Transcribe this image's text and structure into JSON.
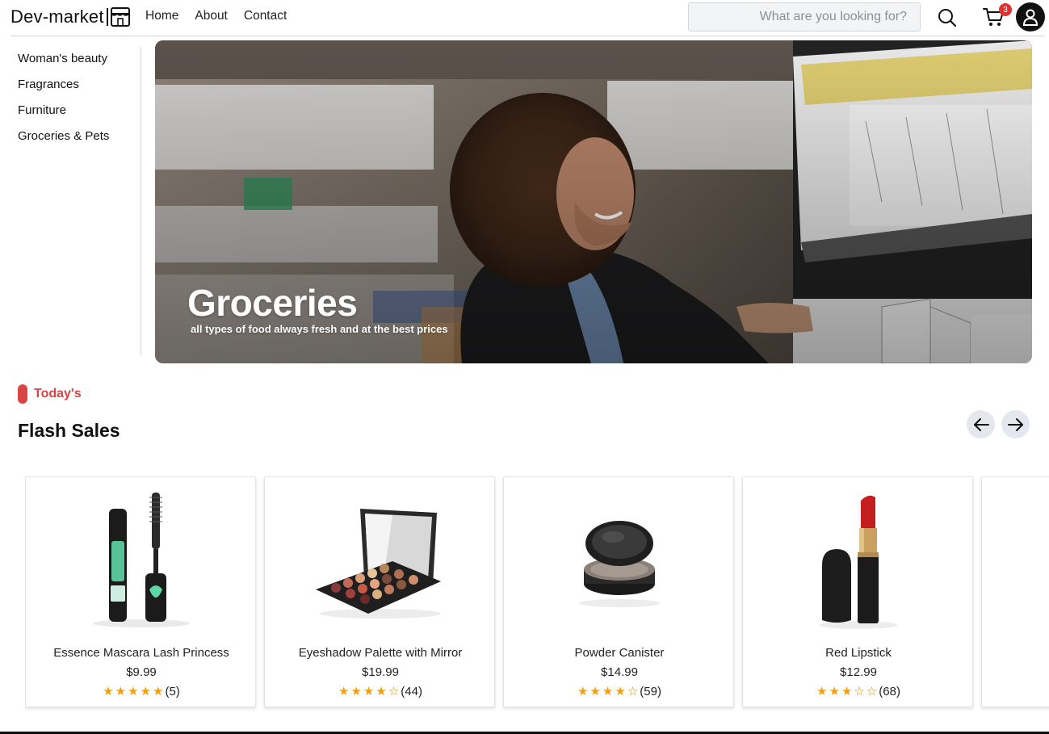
{
  "header": {
    "logo_text": "Dev-market",
    "nav": [
      "Home",
      "About",
      "Contact"
    ],
    "search_placeholder": "What are you looking for?",
    "cart_count": "3"
  },
  "sidebar": {
    "items": [
      "Woman's beauty",
      "Fragrances",
      "Furniture",
      "Groceries & Pets"
    ]
  },
  "hero": {
    "title": "Groceries",
    "subtitle": "all types of food always fresh and at the best prices"
  },
  "section": {
    "tag": "Today's",
    "title": "Flash Sales"
  },
  "products": [
    {
      "name": "Essence Mascara Lash Princess",
      "price": "$9.99",
      "rating": 5,
      "reviews": "(5)",
      "icon": "mascara"
    },
    {
      "name": "Eyeshadow Palette with Mirror",
      "price": "$19.99",
      "rating": 4,
      "reviews": "(44)",
      "icon": "eyeshadow-palette"
    },
    {
      "name": "Powder Canister",
      "price": "$14.99",
      "rating": 4,
      "reviews": "(59)",
      "icon": "powder-compact"
    },
    {
      "name": "Red Lipstick",
      "price": "$12.99",
      "rating": 3,
      "reviews": "(68)",
      "icon": "lipstick"
    }
  ],
  "colors": {
    "accent": "#db4444",
    "star": "#f59e0b",
    "badge": "#e03131"
  }
}
